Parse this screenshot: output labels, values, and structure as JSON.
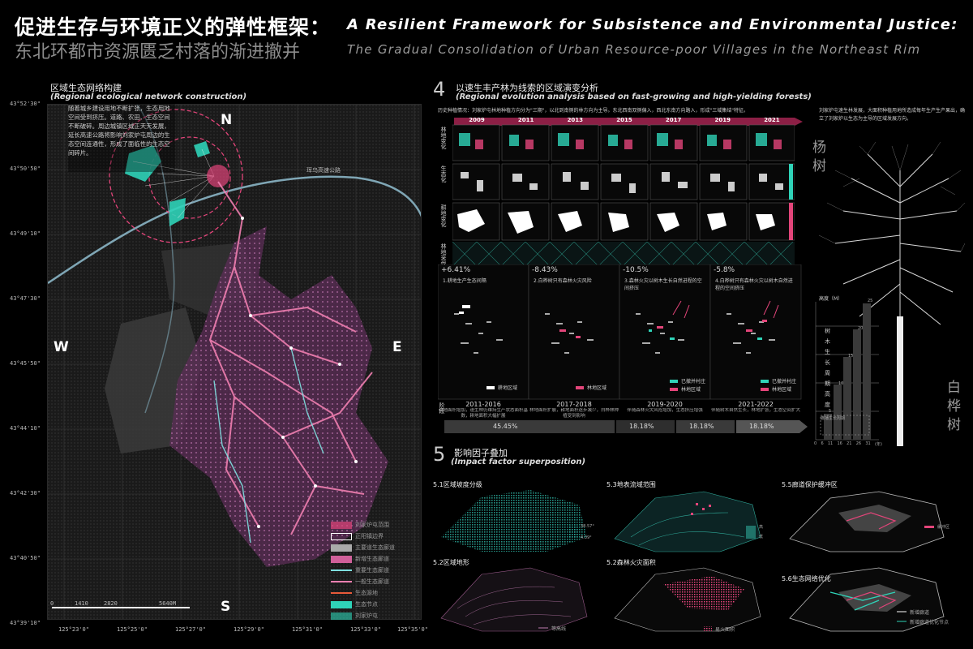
{
  "title": {
    "cn_line1": "促进生存与环境正义的弹性框架：",
    "cn_line2": "东北环都市资源匮乏村落的渐进撤并",
    "en_line1": "A Resilient Framework for Subsistence and Environmental Justice:",
    "en_line2": "The Gradual Consolidation of Urban Resource-poor Villages in the Northeast Rim"
  },
  "map": {
    "section_cn": "区域生态网络构建",
    "section_en": "(Regional ecological network construction)",
    "description": "随着城乡建设用地不断扩张，生态用地空间受到挤压。道路、农田、生态空间不断破碎。周边城镇区域正天天发展，延长高速公路将影响刘家炉屯周边的生态空间连通性，形成了面临性的生态空间碎片。",
    "north": "N",
    "south": "S",
    "east": "E",
    "west": "W",
    "road_label": "珲乌高速公路",
    "lat_labels": [
      "43°52'30\"",
      "43°50'50\"",
      "43°49'10\"",
      "43°47'30\"",
      "43°45'50\"",
      "43°44'10\"",
      "43°42'30\"",
      "43°40'50\"",
      "43°39'10\""
    ],
    "lon_labels": [
      "125°23'0\"",
      "125°25'0\"",
      "125°27'0\"",
      "125°29'0\"",
      "125°31'0\"",
      "125°33'0\"",
      "125°35'0\""
    ],
    "scale": [
      "0",
      "1410",
      "2820",
      "5640M"
    ],
    "legend": [
      "刘家炉屯范围",
      "正阳镇边界",
      "主要道生态廊道",
      "新增生态廊道",
      "重要生态廊道",
      "一般生态廊道",
      "生态源地",
      "生态节点",
      "刘家炉屯"
    ]
  },
  "sec4": {
    "num": "4",
    "cn": "以速生丰产林为线索的区域演变分析",
    "en": "(Regional evolution analysis based on fast-growing and high-yielding forests)",
    "intro": "历史种植情况：刘家炉屯林地种植方向分为\"三期\"，以北到南侧的林方向为主导。东北西南双侧偏入，西北东南方向路入，形成\"三域集结\"特征。",
    "years": [
      "2009",
      "2011",
      "2013",
      "2015",
      "2017",
      "2019",
      "2021"
    ],
    "row_labels": [
      "林地变化",
      "生态化",
      "耕地变化",
      "林地采伐"
    ],
    "right_note": "刘家炉屯速生林发展，大面积种植用地所造成每年生产生产果出，确立了刘家炉以生态为主导的区域发展方向。",
    "pcts": [
      "+6.41%",
      "-8.43%",
      "-10.5%",
      "-5.8%"
    ],
    "stage_titles": [
      "1.耕地生产生态间隔",
      "2.白桦树只有森林火灾风险",
      "3.森林火灾以树木生长自然进程的空间挤压",
      "4.白桦树只有森林火灾以树木自然进程的空间挤压"
    ],
    "legend_a": "耕地区域",
    "legend_b": "已撤并村庄",
    "legend_c": "林地区域",
    "periods": [
      "2011-2016",
      "2017-2018",
      "2019-2020",
      "2021-2022"
    ],
    "period_notes": [
      "耕地面积增加，速生林仍维持生产状态面积基数，耕地面积大幅扩展",
      "林地面积扩展，耕地面积逐步减少，白桦林种植受到影响",
      "伴随森林火灾风险增加，生态挤压增强",
      "伴随树木自然生长，林地扩张，生态空间扩大"
    ],
    "bar_pcts": [
      "45.45%",
      "18.18%",
      "18.18%",
      "18.18%"
    ],
    "left_tag": "阶段",
    "tree1": "杨树",
    "tree2": "白桦树",
    "height_label": "高度（M）",
    "height_ticks": [
      "25",
      "20",
      "15",
      "10",
      "5"
    ],
    "age_ticks": [
      "0",
      "6",
      "11",
      "16",
      "21",
      "26",
      "31"
    ],
    "age_label": "(年)",
    "axis_v": "树木生长周期高度",
    "annotation": "撒播生长周期"
  },
  "sec5": {
    "num": "5",
    "cn": "影响因子叠加",
    "en": "(Impact factor superposition)",
    "panels": [
      "5.1区域坡度分级",
      "5.3地表流域范围",
      "5.5廊道保护缓冲区",
      "5.2区域地形",
      "5.2森林火灾面积",
      "5.6生态网络优化"
    ],
    "slope_max": "38.57°",
    "slope_min": "4.39°",
    "flow_hi": "高",
    "flow_lo": "低",
    "legend_dem": "等高线",
    "legend_fire": "易火面积",
    "legend_buffer": "缓冲区",
    "legend_new": "新增廊道",
    "legend_opt": "新增廊道优化节点"
  },
  "colors": {
    "pink": "#e3457a",
    "teal": "#2fd3b8",
    "white": "#ffffff",
    "bg": "#000000"
  }
}
